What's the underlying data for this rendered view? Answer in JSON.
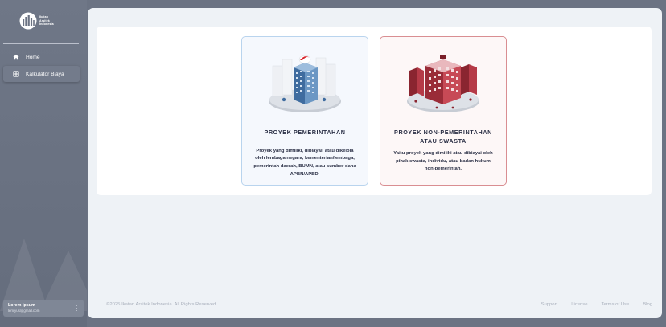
{
  "brand": {
    "line1": "Ikatan",
    "line2": "Arsitek",
    "line3": "Indonesia",
    "logo_icon": "iai-building-logo-icon"
  },
  "sidebar": {
    "items": [
      {
        "label": "Home",
        "icon": "home-icon"
      },
      {
        "label": "Kalkulator Biaya",
        "icon": "grid-calculator-icon",
        "active": true
      }
    ],
    "user": {
      "name": "Lorem Ipsum",
      "email": "lemiyus@gmail.com",
      "menu_icon": "more-vertical-icon"
    }
  },
  "options": [
    {
      "title": "PROYEK PEMERINTAHAN",
      "description": "Proyek yang dimiliki, dibiayai, atau dikelola oleh lembaga negara, kementerian/lembaga, pemerintah daerah, BUMN, atau sumber dana APBN/APBD.",
      "illustration": "government-building-illustration",
      "accent": "#b9d4ee"
    },
    {
      "title": "PROYEK NON-PEMERINTAHAN ATAU SWASTA",
      "description": "Yaitu proyek yang dimiliki atau dibiayai oleh pihak swasta, individu, atau badan hukum non-pemerintah.",
      "illustration": "private-building-illustration",
      "accent": "#d98e92"
    }
  ],
  "footer": {
    "copyright": "©2025 Ikatan Arsitek Indonesia. All Rights Reserved.",
    "links": [
      "Support",
      "License",
      "Terms of Use",
      "Blog"
    ]
  },
  "colors": {
    "sidebar_bg": "#6b7383",
    "main_bg": "#eef2f6",
    "text_dark": "#2a2f45",
    "footer_text": "#aab1bd"
  }
}
